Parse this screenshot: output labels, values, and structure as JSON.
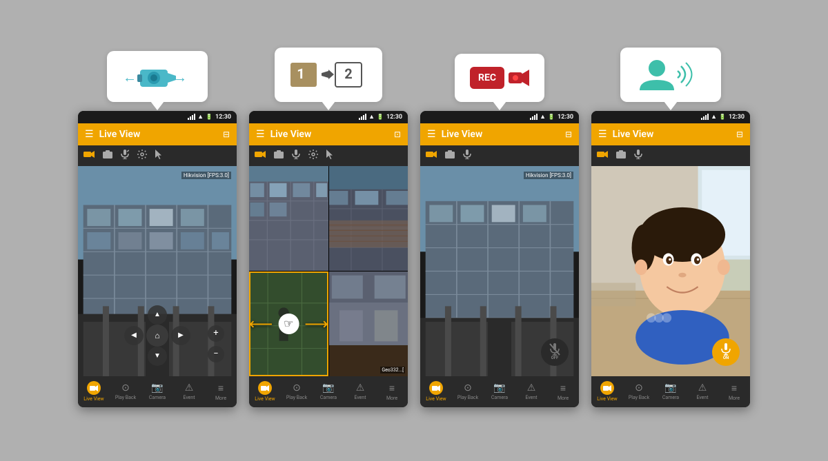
{
  "app": {
    "title": "Live View",
    "time": "12:30"
  },
  "phones": [
    {
      "id": "phone1",
      "tooltip_type": "ptz_camera",
      "header_title": "Live View",
      "has_ptz": true,
      "has_grid": false,
      "has_rec": false,
      "has_audio_on": false,
      "scene": "building",
      "fps_label": "Hikvision [FPS:3.0]",
      "show_fps": true
    },
    {
      "id": "phone2",
      "tooltip_type": "channel_swap",
      "header_title": "Live View",
      "has_ptz": false,
      "has_grid": true,
      "has_rec": false,
      "has_audio_on": false,
      "scene": "grid",
      "fps_label": "",
      "show_fps": false
    },
    {
      "id": "phone3",
      "tooltip_type": "recording",
      "header_title": "Live View",
      "has_ptz": false,
      "has_grid": false,
      "has_rec": true,
      "has_audio_on": false,
      "scene": "building",
      "fps_label": "Hikvision [FPS:3.0]",
      "show_fps": true
    },
    {
      "id": "phone4",
      "tooltip_type": "audio",
      "header_title": "Live View",
      "has_ptz": false,
      "has_grid": false,
      "has_rec": false,
      "has_audio_on": true,
      "scene": "child",
      "fps_label": "",
      "show_fps": false
    }
  ],
  "nav_items": [
    {
      "label": "Live View",
      "icon": "camera",
      "active": true
    },
    {
      "label": "Play Back",
      "icon": "playback",
      "active": false
    },
    {
      "label": "Camera",
      "icon": "camera2",
      "active": false
    },
    {
      "label": "Event",
      "icon": "event",
      "active": false
    },
    {
      "label": "More",
      "icon": "more",
      "active": false
    }
  ],
  "colors": {
    "accent": "#f0a500",
    "header_bg": "#f0a500",
    "toolbar_bg": "#2a2a2a",
    "app_bg": "#1a1a1a",
    "nav_bg": "#2a2a2a",
    "active_nav": "#f0a500"
  },
  "tooltips": {
    "ptz_camera": "PTZ Camera control",
    "channel_swap": "Channel swap 1 to 2",
    "recording": "REC Recording",
    "audio": "Audio talk"
  }
}
